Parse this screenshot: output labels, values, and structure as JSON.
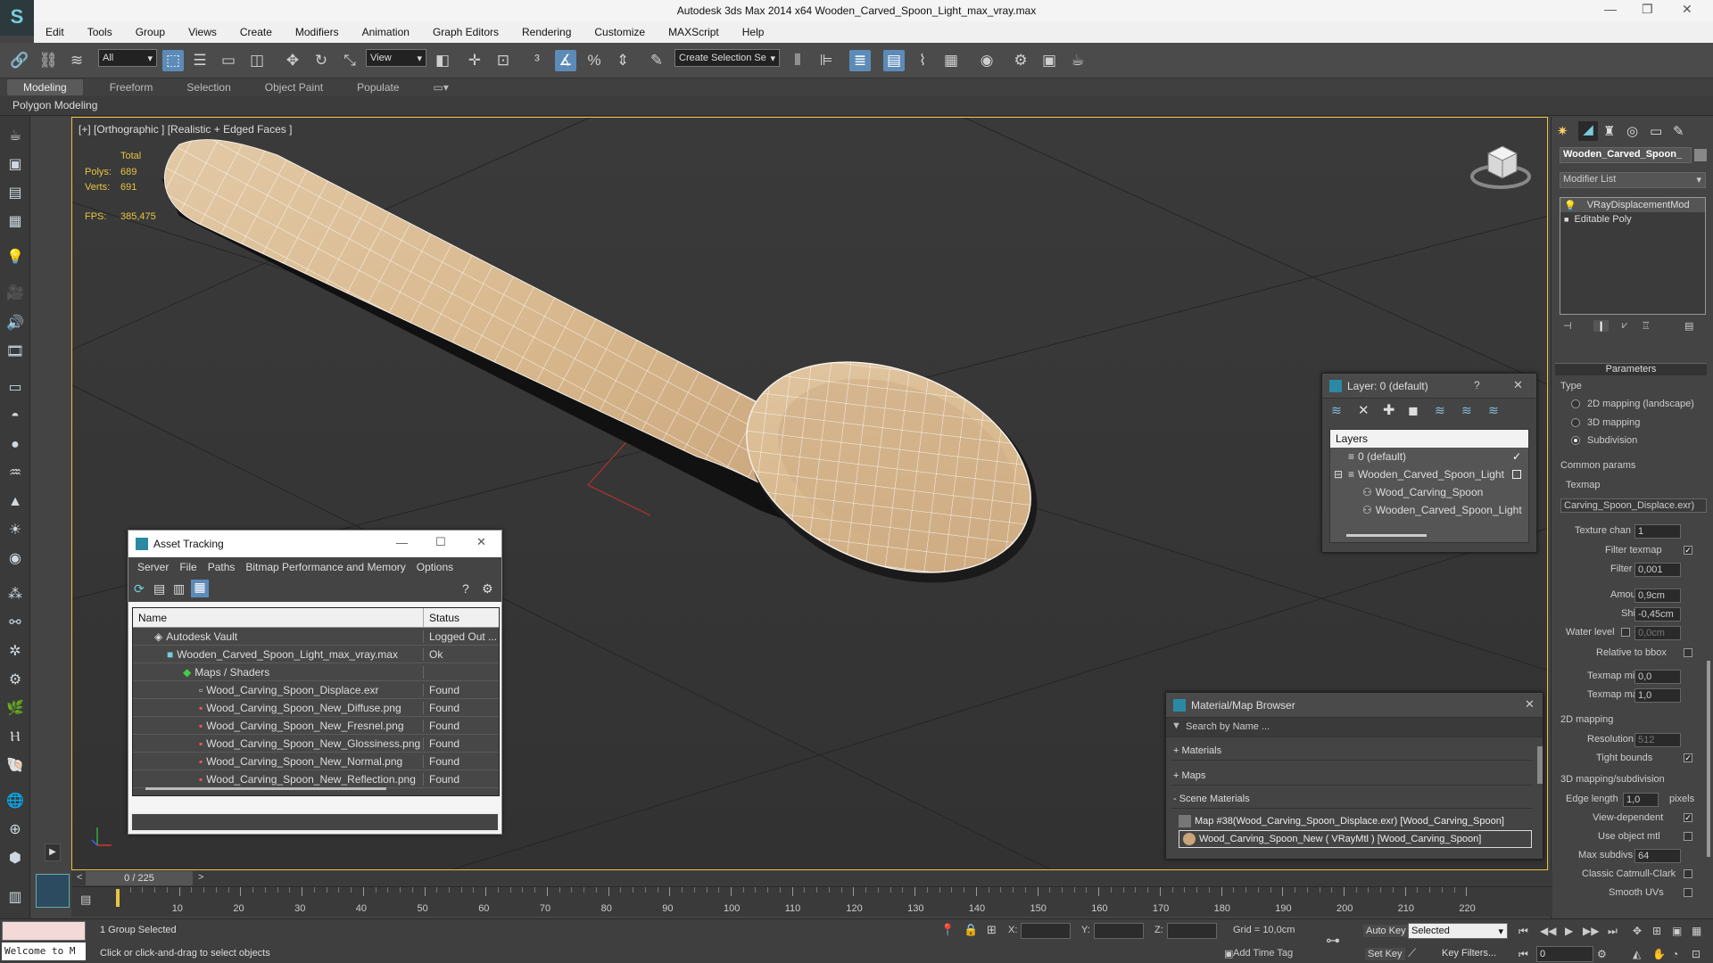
{
  "app": {
    "title": "Autodesk 3ds Max  2014 x64     Wooden_Carved_Spoon_Light_max_vray.max"
  },
  "menu": [
    "Edit",
    "Tools",
    "Group",
    "Views",
    "Create",
    "Modifiers",
    "Animation",
    "Graph Editors",
    "Rendering",
    "Customize",
    "MAXScript",
    "Help"
  ],
  "toolbar": {
    "filter_value": "All",
    "refcoord_value": "View",
    "named_selection_placeholder": "Create Selection Se"
  },
  "ribbon": {
    "tabs": [
      "Modeling",
      "Freeform",
      "Selection",
      "Object Paint",
      "Populate"
    ],
    "active": "Modeling",
    "sub": "Polygon Modeling"
  },
  "viewport": {
    "label": "[+] [Orthographic ] [Realistic + Edged Faces ]",
    "stats": {
      "total_label": "Total",
      "polys_label": "Polys:",
      "polys": "689",
      "verts_label": "Verts:",
      "verts": "691",
      "fps_label": "FPS:",
      "fps": "385,475"
    }
  },
  "asset_tracking": {
    "title": "Asset Tracking",
    "menu": [
      "Server",
      "File",
      "Paths",
      "Bitmap Performance and Memory",
      "Options"
    ],
    "columns": [
      "Name",
      "Status"
    ],
    "rows": [
      {
        "name": "Autodesk Vault",
        "status": "Logged Out ..."
      },
      {
        "name": "Wooden_Carved_Spoon_Light_max_vray.max",
        "status": "Ok"
      },
      {
        "name": "Maps / Shaders",
        "status": ""
      },
      {
        "name": "Wood_Carving_Spoon_Displace.exr",
        "status": "Found"
      },
      {
        "name": "Wood_Carving_Spoon_New_Diffuse.png",
        "status": "Found"
      },
      {
        "name": "Wood_Carving_Spoon_New_Fresnel.png",
        "status": "Found"
      },
      {
        "name": "Wood_Carving_Spoon_New_Glossiness.png",
        "status": "Found"
      },
      {
        "name": "Wood_Carving_Spoon_New_Normal.png",
        "status": "Found"
      },
      {
        "name": "Wood_Carving_Spoon_New_Reflection.png",
        "status": "Found"
      }
    ]
  },
  "layer_panel": {
    "title": "Layer: 0 (default)",
    "help": "?",
    "header": "Layers",
    "items": [
      "0 (default)",
      "Wooden_Carved_Spoon_Light",
      "Wood_Carving_Spoon",
      "Wooden_Carved_Spoon_Light"
    ]
  },
  "material_browser": {
    "title": "Material/Map Browser",
    "search_placeholder": "Search by Name ...",
    "groups": [
      "+ Materials",
      "+ Maps",
      "- Scene Materials"
    ],
    "items": [
      "Map #38(Wood_Carving_Spoon_Displace.exr) [Wood_Carving_Spoon]",
      "Wood_Carving_Spoon_New ( VRayMtl ) [Wood_Carving_Spoon]"
    ]
  },
  "command_panel": {
    "object_name": "Wooden_Carved_Spoon_",
    "modifier_list": "Modifier List",
    "stack": [
      "VRayDisplacementMod",
      "Editable Poly"
    ],
    "rollout": "Parameters",
    "type_label": "Type",
    "types": [
      "2D mapping (landscape)",
      "3D mapping",
      "Subdivision"
    ],
    "common_params": "Common params",
    "texmap_label": "Texmap",
    "texmap_value": "Carving_Spoon_Displace.exr)",
    "texture_chan_label": "Texture chan",
    "texture_chan": "1",
    "filter_texmap_label": "Filter texmap",
    "filter_blur_label": "Filter blur",
    "filter_blur": "0,001",
    "amount_label": "Amount",
    "amount": "0,9cm",
    "shift_label": "Shift",
    "shift": "-0,45cm",
    "water_level_label": "Water level",
    "water_level": "0,0cm",
    "relative_bbox_label": "Relative to bbox",
    "texmap_min_label": "Texmap min",
    "texmap_min": "0,0",
    "texmap_max_label": "Texmap max",
    "texmap_max": "1,0",
    "mapping2d_label": "2D mapping",
    "resolution_label": "Resolution",
    "resolution": "512",
    "tight_bounds_label": "Tight bounds",
    "mapping3d_label": "3D mapping/subdivision",
    "edge_length_label": "Edge length",
    "edge_length": "1,0",
    "pixels_label": "pixels",
    "view_dependent_label": "View-dependent",
    "use_object_mtl_label": "Use object mtl",
    "max_subdivs_label": "Max subdivs",
    "max_subdivs": "64",
    "classic_label": "Classic Catmull-Clark",
    "smooth_uvs_label": "Smooth UVs"
  },
  "timeline": {
    "frame": "0 / 225",
    "ticks": [
      "10",
      "20",
      "30",
      "40",
      "50",
      "60",
      "70",
      "80",
      "90",
      "100",
      "110",
      "120",
      "130",
      "140",
      "150",
      "160",
      "170",
      "180",
      "190",
      "200",
      "210",
      "220"
    ]
  },
  "status": {
    "welcome": "Welcome to M",
    "selected": "1 Group Selected",
    "prompt": "Click or click-and-drag to select objects",
    "x_label": "X:",
    "y_label": "Y:",
    "z_label": "Z:",
    "grid": "Grid = 10,0cm",
    "add_time_tag": "Add Time Tag",
    "auto_key": "Auto Key",
    "selected_dropdown": "Selected",
    "set_key": "Set Key",
    "key_filters": "Key Filters...",
    "frame_value": "0"
  }
}
